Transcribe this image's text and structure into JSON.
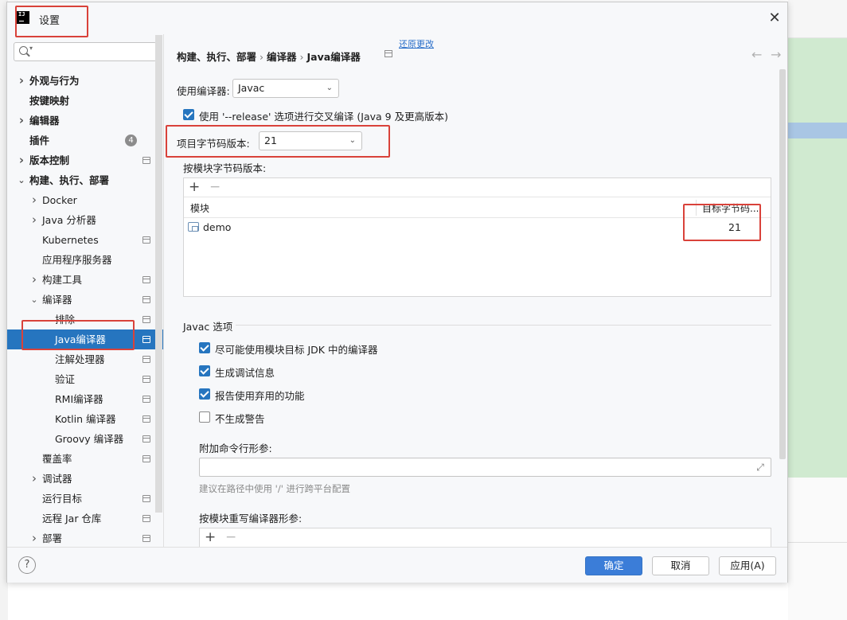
{
  "window": {
    "title": "设置"
  },
  "search": {
    "placeholder": ""
  },
  "sidebar": {
    "items": [
      {
        "label": "外观与行为",
        "bold": true,
        "chevron": "right"
      },
      {
        "label": "按键映射",
        "bold": true,
        "chevron": ""
      },
      {
        "label": "编辑器",
        "bold": true,
        "chevron": "right"
      },
      {
        "label": "插件",
        "bold": true,
        "chevron": "",
        "badge": "4"
      },
      {
        "label": "版本控制",
        "bold": true,
        "chevron": "right"
      },
      {
        "label": "构建、执行、部署",
        "bold": true,
        "chevron": "down"
      },
      {
        "label": "Docker",
        "chevron": "right"
      },
      {
        "label": "Java 分析器",
        "chevron": "right"
      },
      {
        "label": "Kubernetes",
        "chevron": ""
      },
      {
        "label": "应用程序服务器",
        "chevron": ""
      },
      {
        "label": "构建工具",
        "chevron": "right"
      },
      {
        "label": "编译器",
        "chevron": "down"
      },
      {
        "label": "排除",
        "chevron": ""
      },
      {
        "label": "Java编译器",
        "chevron": "",
        "selected": true
      },
      {
        "label": "注解处理器",
        "chevron": ""
      },
      {
        "label": "验证",
        "chevron": ""
      },
      {
        "label": "RMI编译器",
        "chevron": ""
      },
      {
        "label": "Kotlin 编译器",
        "chevron": ""
      },
      {
        "label": "Groovy 编译器",
        "chevron": ""
      },
      {
        "label": "覆盖率",
        "chevron": ""
      },
      {
        "label": "调试器",
        "chevron": "right"
      },
      {
        "label": "运行目标",
        "chevron": ""
      },
      {
        "label": "远程 Jar 仓库",
        "chevron": ""
      },
      {
        "label": "部署",
        "chevron": "right"
      }
    ]
  },
  "breadcrumb": {
    "parts": [
      "构建、执行、部署",
      "编译器",
      "Java编译器"
    ],
    "separator": "›",
    "reset_link": "还原更改"
  },
  "main": {
    "compiler_label": "使用编译器:",
    "compiler_value": "Javac",
    "release_option_label": "使用 '--release' 选项进行交叉编译 (Java 9 及更高版本)",
    "release_option_checked": true,
    "project_bytecode_label": "项目字节码版本:",
    "project_bytecode_value": "21",
    "module_bytecode_label": "按模块字节码版本:",
    "module_table": {
      "columns": [
        "模块",
        "目标字节码..."
      ],
      "rows": [
        {
          "module": "demo",
          "target": "21"
        }
      ]
    },
    "javac_section_title": "Javac 选项",
    "javac_options": [
      {
        "label": "尽可能使用模块目标 JDK 中的编译器",
        "checked": true
      },
      {
        "label": "生成调试信息",
        "checked": true
      },
      {
        "label": "报告使用弃用的功能",
        "checked": true
      },
      {
        "label": "不生成警告",
        "checked": false
      }
    ],
    "extra_params_label": "附加命令行形参:",
    "extra_params_value": "",
    "extra_params_hint": "建议在路径中使用 '/' 进行跨平台配置",
    "override_params_label": "按模块重写编译器形参:"
  },
  "buttons": {
    "ok": "确定",
    "cancel": "取消",
    "apply": "应用(A)"
  },
  "colors": {
    "accent": "#2675bf",
    "annotation": "#d9423a"
  }
}
